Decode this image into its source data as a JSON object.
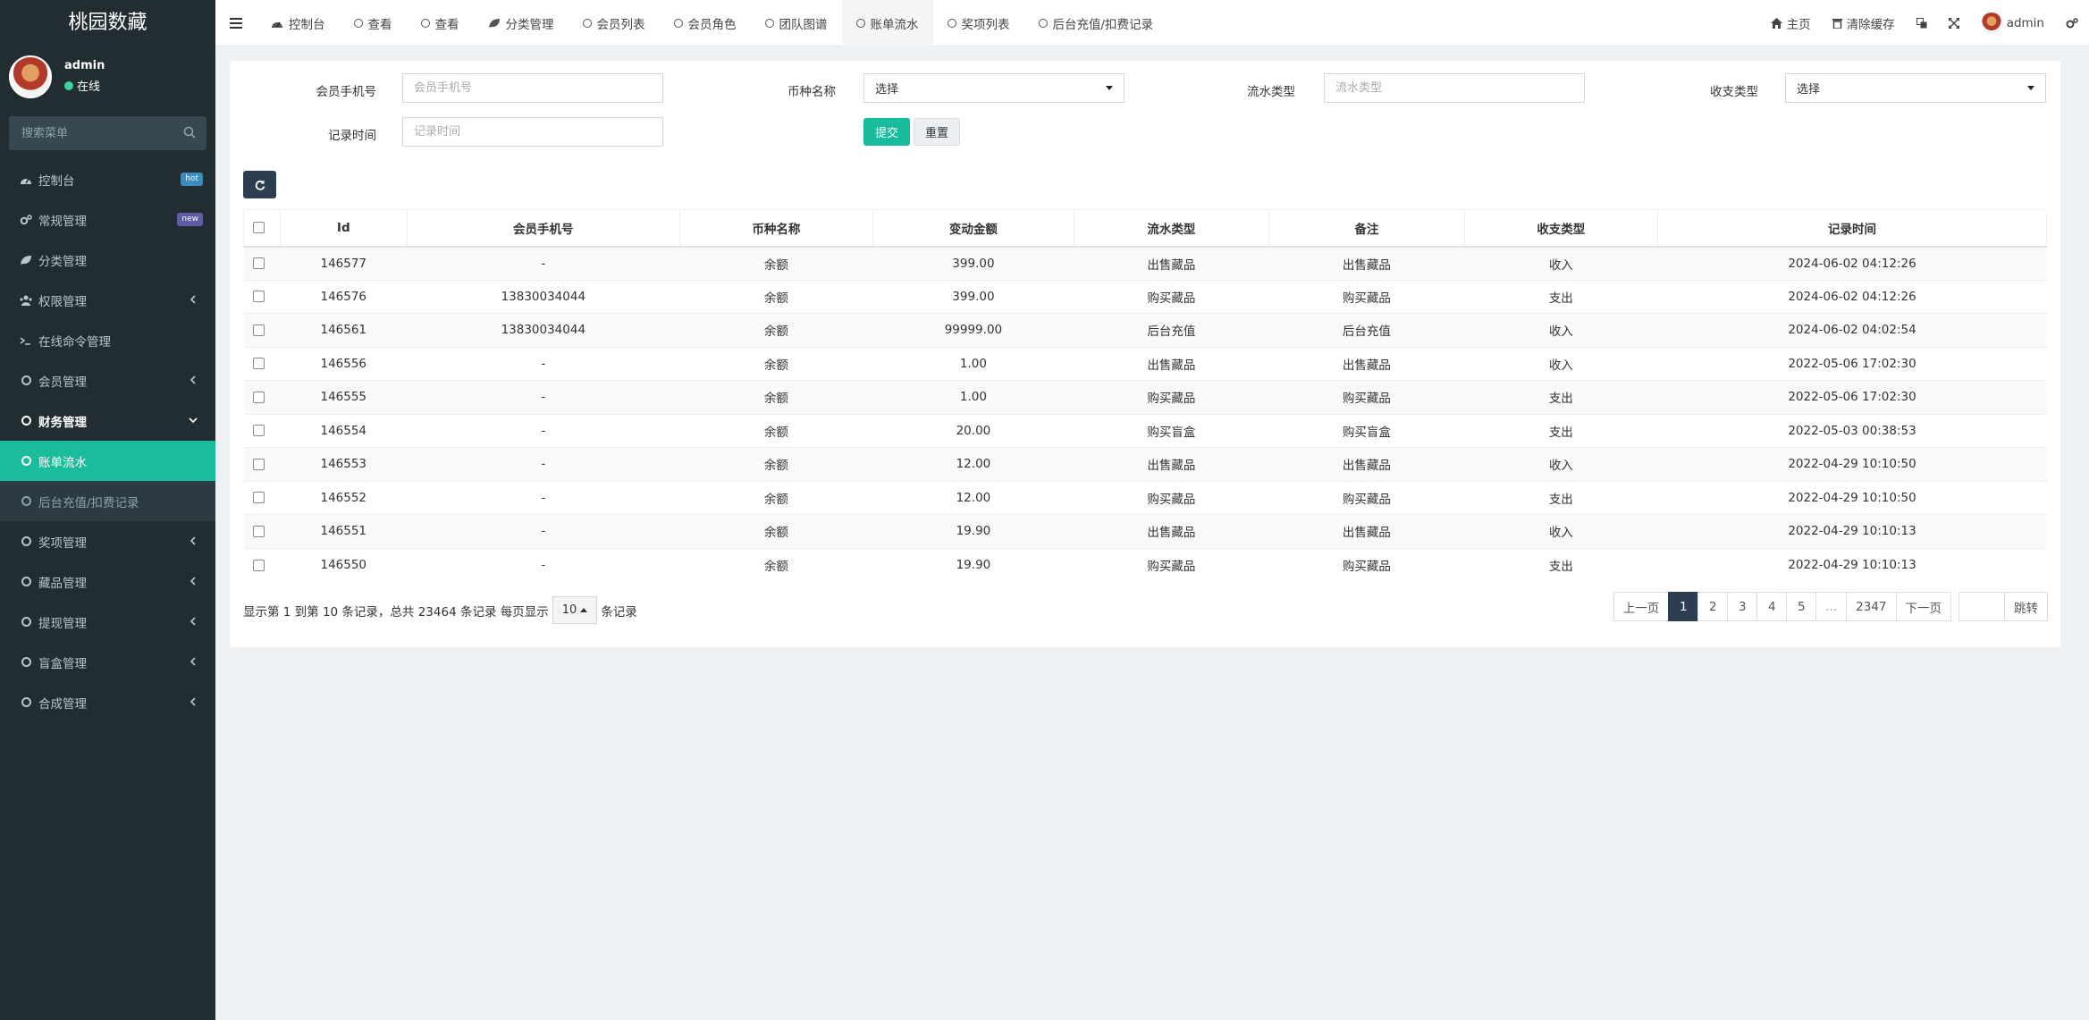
{
  "app": {
    "brand": "桃园数藏"
  },
  "user": {
    "name": "admin",
    "status": "在线"
  },
  "sidebar": {
    "search_placeholder": "搜索菜单",
    "items": [
      {
        "label": "控制台",
        "icon": "dashboard-icon",
        "badge": "hot"
      },
      {
        "label": "常规管理",
        "icon": "cogs-icon",
        "badge": "new"
      },
      {
        "label": "分类管理",
        "icon": "leaf-icon"
      },
      {
        "label": "权限管理",
        "icon": "group-icon",
        "arrow": true
      },
      {
        "label": "在线命令管理",
        "icon": "terminal-icon"
      },
      {
        "label": "会员管理",
        "icon": "circle-icon",
        "arrow": true
      },
      {
        "label": "财务管理",
        "icon": "circle-icon",
        "open": true
      },
      {
        "label": "账单流水",
        "icon": "circle-icon",
        "active": true
      },
      {
        "label": "后台充值/扣费记录",
        "icon": "circle-icon",
        "sub": true
      },
      {
        "label": "奖项管理",
        "icon": "circle-icon",
        "arrow": true
      },
      {
        "label": "藏品管理",
        "icon": "circle-icon",
        "arrow": true
      },
      {
        "label": "提现管理",
        "icon": "circle-icon",
        "arrow": true
      },
      {
        "label": "盲盒管理",
        "icon": "circle-icon",
        "arrow": true
      },
      {
        "label": "合成管理",
        "icon": "circle-icon",
        "arrow": true
      }
    ]
  },
  "topbar": {
    "tabs": [
      {
        "label": "控制台",
        "icon": "dashboard-icon"
      },
      {
        "label": "查看",
        "icon": "circle-icon"
      },
      {
        "label": "查看",
        "icon": "circle-icon"
      },
      {
        "label": "分类管理",
        "icon": "leaf-icon"
      },
      {
        "label": "会员列表",
        "icon": "circle-icon"
      },
      {
        "label": "会员角色",
        "icon": "circle-icon"
      },
      {
        "label": "团队图谱",
        "icon": "circle-icon"
      },
      {
        "label": "账单流水",
        "icon": "circle-icon",
        "active": true
      },
      {
        "label": "奖项列表",
        "icon": "circle-icon"
      },
      {
        "label": "后台充值/扣费记录",
        "icon": "circle-icon"
      }
    ],
    "home": "主页",
    "clear_cache": "清除缓存",
    "admin": "admin"
  },
  "filters": {
    "phone_label": "会员手机号",
    "phone_placeholder": "会员手机号",
    "coin_label": "币种名称",
    "coin_value": "选择",
    "flow_label": "流水类型",
    "flow_placeholder": "流水类型",
    "io_label": "收支类型",
    "io_value": "选择",
    "time_label": "记录时间",
    "time_placeholder": "记录时间",
    "submit": "提交",
    "reset": "重置"
  },
  "table": {
    "headers": [
      "Id",
      "会员手机号",
      "币种名称",
      "变动金额",
      "流水类型",
      "备注",
      "收支类型",
      "记录时间"
    ],
    "rows": [
      [
        "146577",
        "-",
        "余额",
        "399.00",
        "出售藏品",
        "出售藏品",
        "收入",
        "2024-06-02 04:12:26"
      ],
      [
        "146576",
        "13830034044",
        "余额",
        "399.00",
        "购买藏品",
        "购买藏品",
        "支出",
        "2024-06-02 04:12:26"
      ],
      [
        "146561",
        "13830034044",
        "余额",
        "99999.00",
        "后台充值",
        "后台充值",
        "收入",
        "2024-06-02 04:02:54"
      ],
      [
        "146556",
        "-",
        "余额",
        "1.00",
        "出售藏品",
        "出售藏品",
        "收入",
        "2022-05-06 17:02:30"
      ],
      [
        "146555",
        "-",
        "余额",
        "1.00",
        "购买藏品",
        "购买藏品",
        "支出",
        "2022-05-06 17:02:30"
      ],
      [
        "146554",
        "-",
        "余额",
        "20.00",
        "购买盲盒",
        "购买盲盒",
        "支出",
        "2022-05-03 00:38:53"
      ],
      [
        "146553",
        "-",
        "余额",
        "12.00",
        "出售藏品",
        "出售藏品",
        "收入",
        "2022-04-29 10:10:50"
      ],
      [
        "146552",
        "-",
        "余额",
        "12.00",
        "购买藏品",
        "购买藏品",
        "支出",
        "2022-04-29 10:10:50"
      ],
      [
        "146551",
        "-",
        "余额",
        "19.90",
        "出售藏品",
        "出售藏品",
        "收入",
        "2022-04-29 10:10:13"
      ],
      [
        "146550",
        "-",
        "余额",
        "19.90",
        "购买藏品",
        "购买藏品",
        "支出",
        "2022-04-29 10:10:13"
      ]
    ]
  },
  "pagination": {
    "info_prefix": "显示第 1 到第 10 条记录，总共 23464 条记录 每页显示",
    "page_size": "10",
    "info_suffix": "条记录",
    "prev": "上一页",
    "pages": [
      "1",
      "2",
      "3",
      "4",
      "5",
      "...",
      "2347"
    ],
    "next": "下一页",
    "jump": "跳转"
  },
  "colors": {
    "sidebar": "#222d32",
    "accent": "#18bc9c",
    "dark": "#2c3e50"
  }
}
